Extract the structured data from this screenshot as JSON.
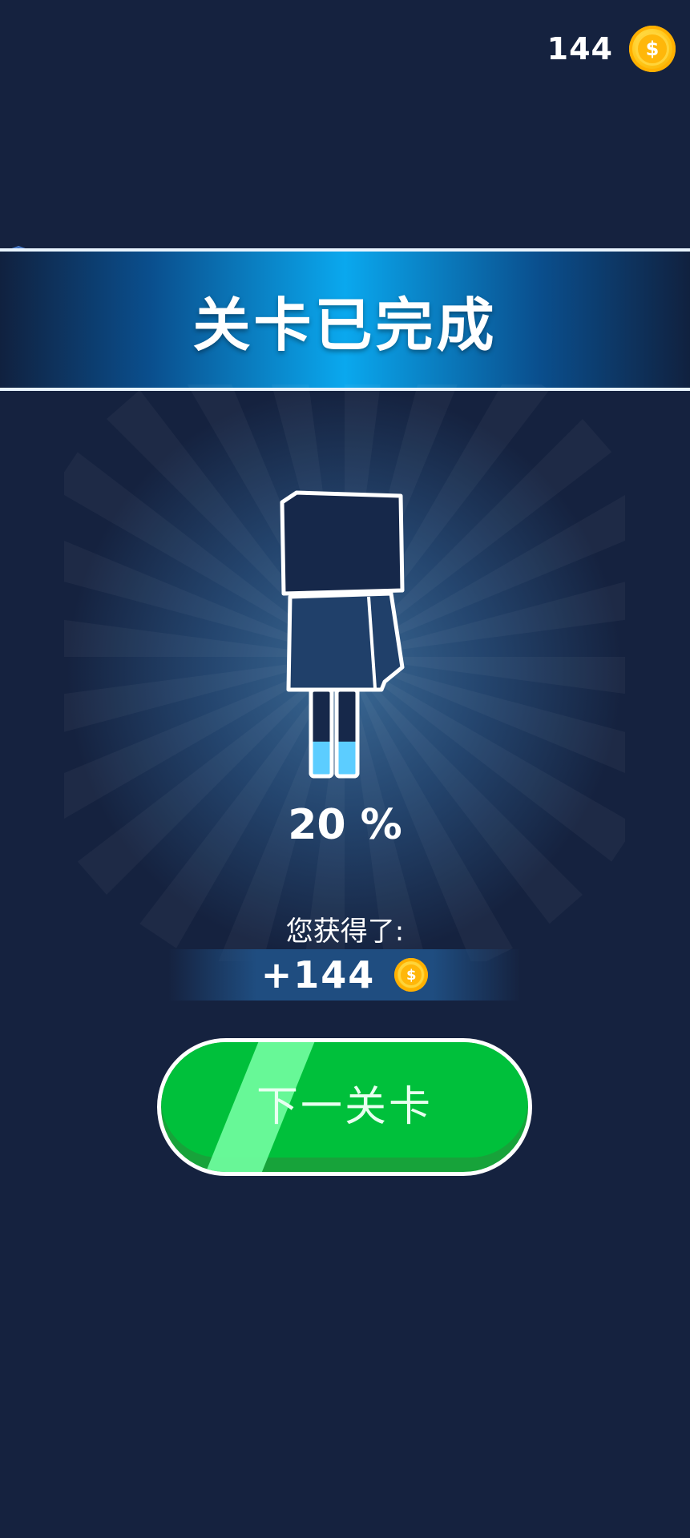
{
  "hud": {
    "coin_total": "144"
  },
  "banner": {
    "title": "关卡已完成"
  },
  "progress": {
    "percent_text": "20 %",
    "fill_fraction": 0.2
  },
  "reward": {
    "label": "您获得了:",
    "amount": "+144"
  },
  "next_button": {
    "label": "下一关卡"
  },
  "colors": {
    "background": "#15223f",
    "banner_accent": "#0aa8ee",
    "button_green": "#00c03b",
    "coin_gold": "#ffc414",
    "fill_blue": "#5ccdff"
  },
  "icons": {
    "coin": "coin-icon",
    "shield": "shield-icon"
  }
}
